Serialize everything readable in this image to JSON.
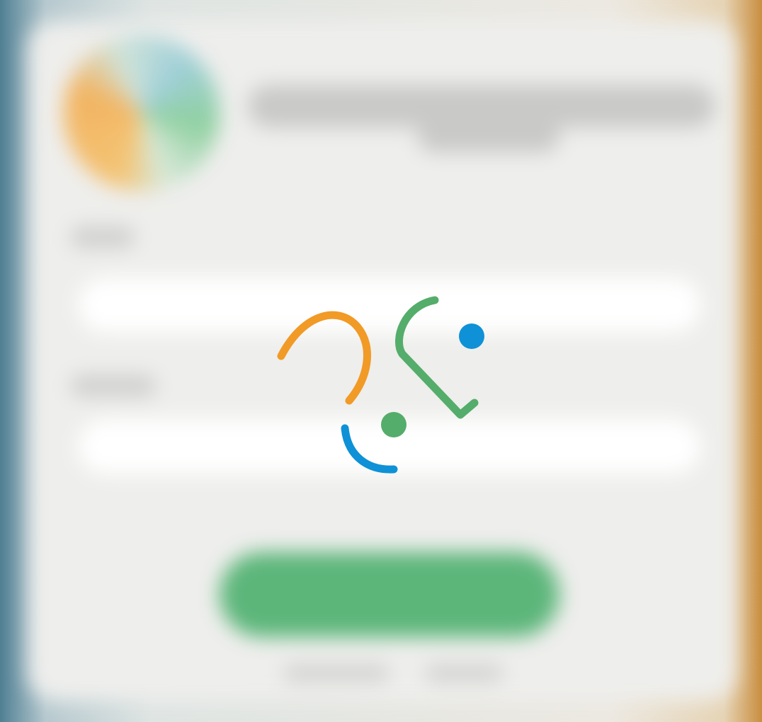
{
  "screen": {
    "state": "loading",
    "background": "blurred-login-form"
  },
  "spinner": {
    "icon": "loading-spinner-icon",
    "colors": {
      "orange": "#f19a26",
      "green": "#54ad6a",
      "blue": "#0e91d6"
    }
  },
  "colors": {
    "card": "#eeeeec",
    "login_button": "#5cb67a",
    "input": "#ffffff"
  }
}
